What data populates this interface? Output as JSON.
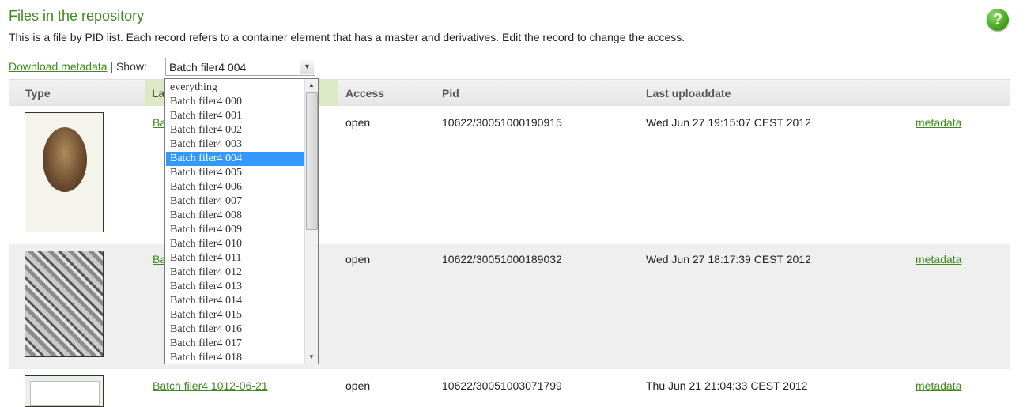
{
  "page": {
    "title": "Files in the repository",
    "subtitle": "This is a file by PID list. Each record refers to a container element that has a master and derivatives. Edit the record to change the access.",
    "help_label": "?"
  },
  "toolbar": {
    "download_label": "Download metadata",
    "separator": "|",
    "show_label": "Show:",
    "selected_value": "Batch filer4 004"
  },
  "table": {
    "headers": {
      "type": "Type",
      "label": "La",
      "access": "Access",
      "pid": "Pid",
      "date": "Last uploaddate"
    },
    "rows": [
      {
        "label": "Bat",
        "access": "open",
        "pid": "10622/30051000190915",
        "date": "Wed Jun 27 19:15:07 CEST 2012",
        "action": "metadata"
      },
      {
        "label": "Bat",
        "access": "open",
        "pid": "10622/30051000189032",
        "date": "Wed Jun 27 18:17:39 CEST 2012",
        "action": "metadata"
      },
      {
        "label": "Batch filer4 1012-06-21",
        "access": "open",
        "pid": "10622/30051003071799",
        "date": "Thu Jun 21 21:04:33 CEST 2012",
        "action": "metadata"
      }
    ]
  },
  "dropdown": {
    "options": [
      "everything",
      "Batch filer4 000",
      "Batch filer4 001",
      "Batch filer4 002",
      "Batch filer4 003",
      "Batch filer4 004",
      "Batch filer4 005",
      "Batch filer4 006",
      "Batch filer4 007",
      "Batch filer4 008",
      "Batch filer4 009",
      "Batch filer4 010",
      "Batch filer4 011",
      "Batch filer4 012",
      "Batch filer4 013",
      "Batch filer4 014",
      "Batch filer4 015",
      "Batch filer4 016",
      "Batch filer4 017",
      "Batch filer4 018"
    ],
    "selected_index": 5
  },
  "colors": {
    "accent_green": "#3e8a1e",
    "selection_blue": "#3399ff",
    "header_highlight": "#dce9c4"
  },
  "icons": {
    "help": "help-icon",
    "dropdown_arrow": "chevron-down-icon"
  }
}
